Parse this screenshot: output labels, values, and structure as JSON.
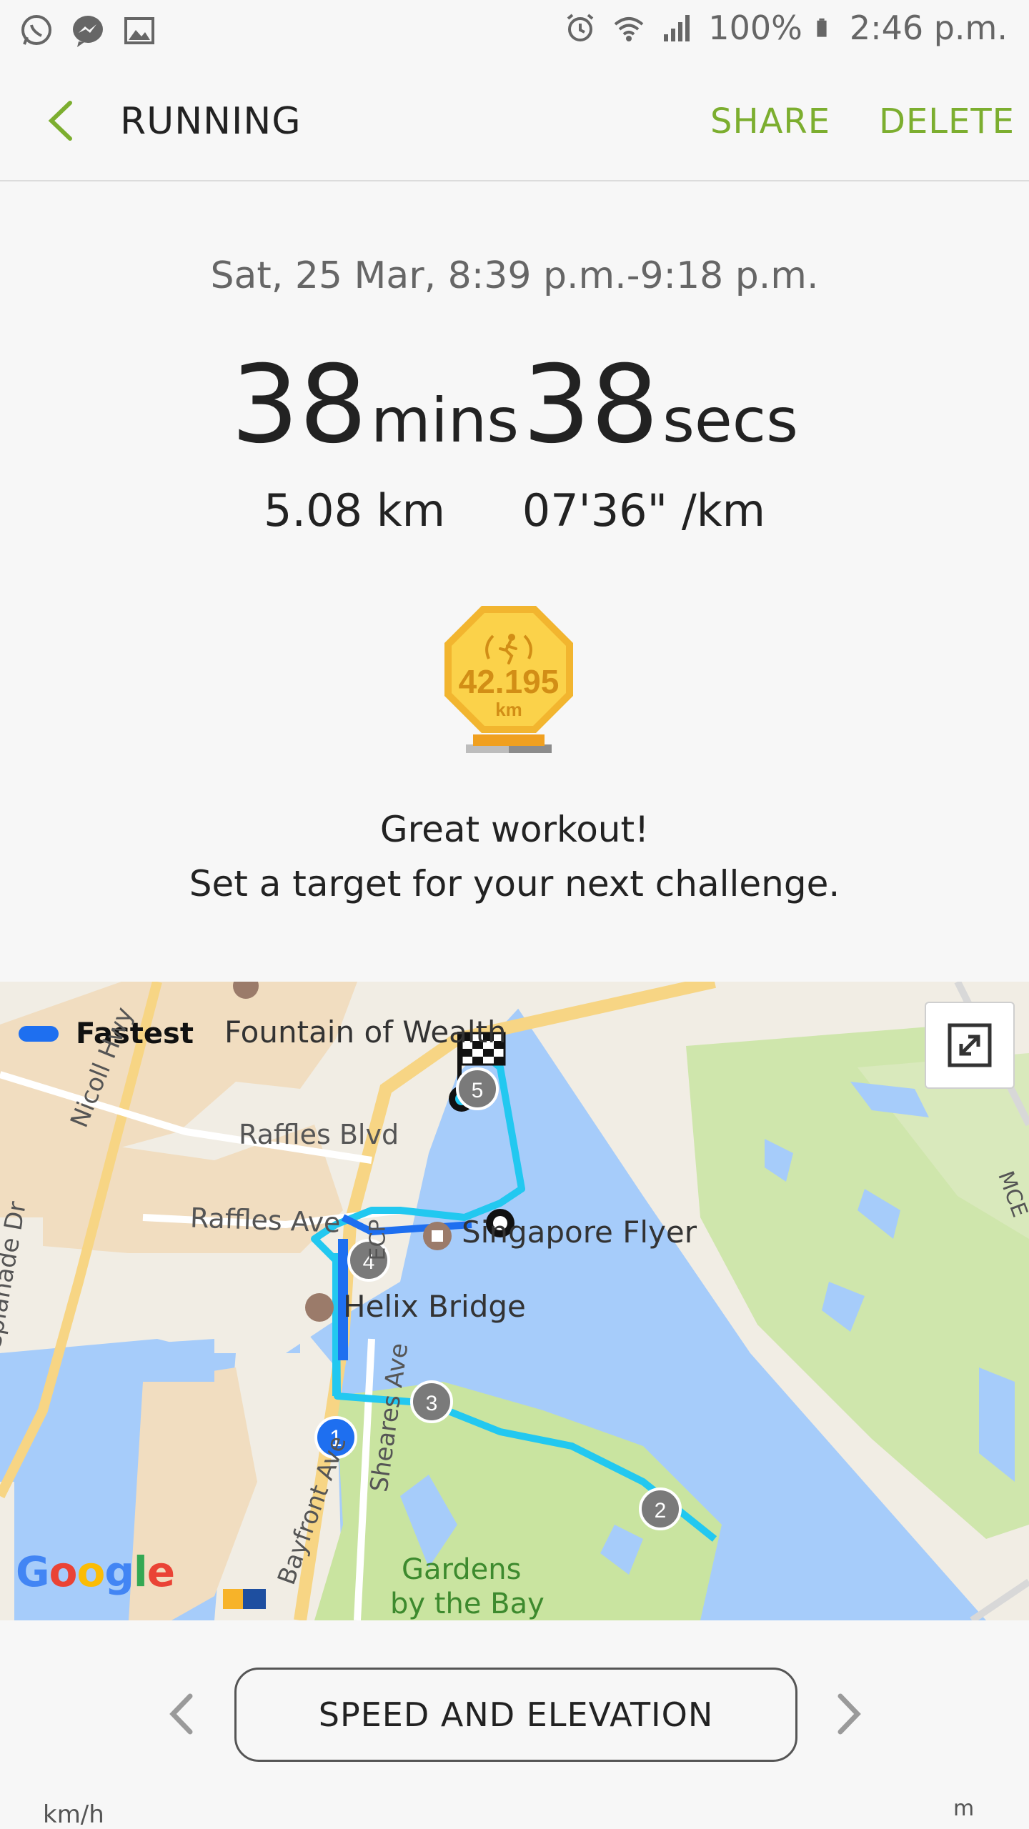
{
  "status_bar": {
    "left_icons": [
      "whatsapp-icon",
      "messenger-icon",
      "gallery-icon"
    ],
    "right_icons": [
      "alarm-icon",
      "wifi-icon",
      "signal-icon",
      "battery-icon"
    ],
    "battery": "100%",
    "time": "2:46 p.m."
  },
  "app_bar": {
    "back_icon": "chevron-left-icon",
    "title": "RUNNING",
    "share": "SHARE",
    "delete": "DELETE",
    "accent_color": "#7cae2f"
  },
  "summary": {
    "datetime": "Sat, 25 Mar, 8:39 p.m.-9:18 p.m.",
    "minutes": "38",
    "minutes_unit": "mins",
    "seconds": "38",
    "seconds_unit": "secs",
    "distance": "5.08 km",
    "pace": "07'36\" /km"
  },
  "medal": {
    "value": "42.195",
    "unit": "km",
    "icon": "runner-laurel-icon"
  },
  "message": {
    "line1": "Great workout!",
    "line2": "Set a target for your next challenge."
  },
  "map": {
    "legend": "Fastest",
    "legend_color": "#1e6ff0",
    "route_color": "#22c8f0",
    "labels": {
      "fountain": "Fountain of Wealth",
      "raffles_blvd": "Raffles Blvd",
      "raffles_ave": "Raffles Ave",
      "singapore_flyer": "Singapore Flyer",
      "helix_bridge": "Helix Bridge",
      "esplanade_dr": "Esplanade Dr",
      "nicoll_hwy": "Nicoll Hwy",
      "sheares_ave": "Sheares Ave",
      "bayfront_ave": "Bayfront Ave",
      "ecp": "ECP",
      "mce": "MCE",
      "gardens_line1": "Gardens",
      "gardens_line2": "by the Bay"
    },
    "markers": [
      "1",
      "2",
      "3",
      "4",
      "5"
    ],
    "google": "Google"
  },
  "bottom": {
    "chart_button": "SPEED AND ELEVATION",
    "axis_left": "km/h",
    "axis_right": "m"
  }
}
